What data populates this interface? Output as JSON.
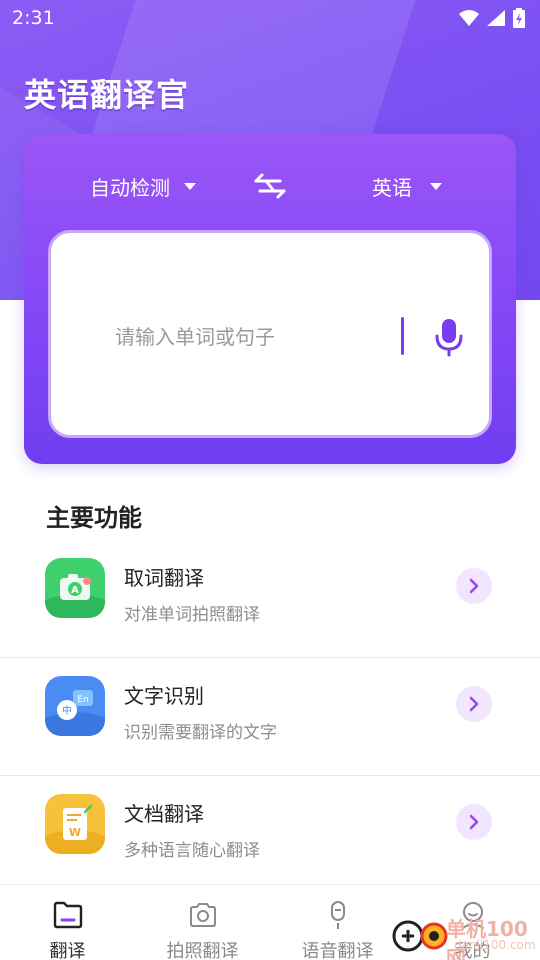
{
  "status_bar": {
    "time": "2:31"
  },
  "app": {
    "title": "英语翻译官"
  },
  "translator": {
    "source_lang": "自动检测",
    "target_lang": "英语",
    "input_placeholder": "请输入单词或句子"
  },
  "main": {
    "section_title": "主要功能",
    "features": [
      {
        "title": "取词翻译",
        "subtitle": "对准单词拍照翻译",
        "icon": "camera-scan-icon"
      },
      {
        "title": "文字识别",
        "subtitle": "识别需要翻译的文字",
        "icon": "text-recognition-icon"
      },
      {
        "title": "文档翻译",
        "subtitle": "多种语言随心翻译",
        "icon": "document-icon"
      }
    ]
  },
  "bottom_nav": {
    "items": [
      {
        "label": "翻译",
        "icon": "folder-icon",
        "active": true
      },
      {
        "label": "拍照翻译",
        "icon": "camera-icon",
        "active": false
      },
      {
        "label": "语音翻译",
        "icon": "microphone-icon",
        "active": false
      },
      {
        "label": "我的",
        "icon": "profile-icon",
        "active": false
      }
    ]
  },
  "watermark": {
    "text": "单机100网",
    "url": "danji100.com"
  },
  "colors": {
    "primary": "#7b4ff2",
    "accent_light": "#f1e6fd",
    "feature1": "#3ecf6e",
    "feature2": "#4a8cf3",
    "feature3": "#f7c23b"
  }
}
